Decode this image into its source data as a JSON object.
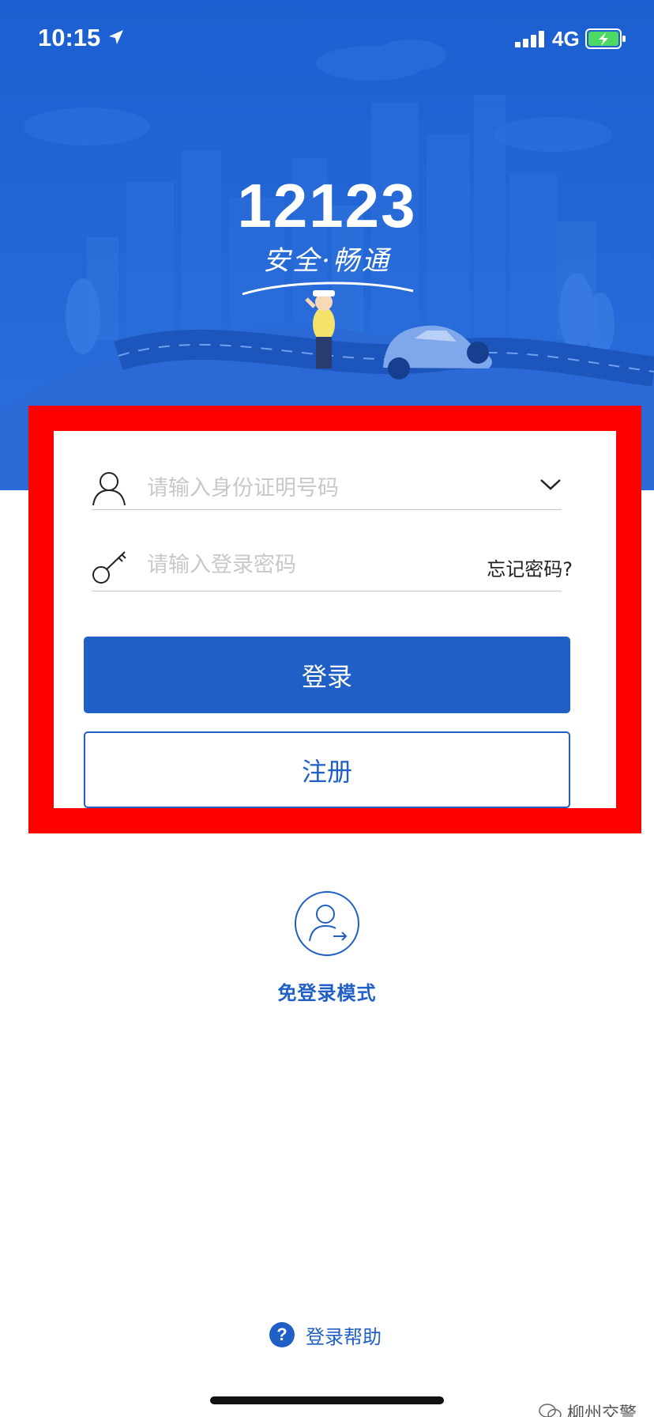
{
  "status_bar": {
    "time": "10:15",
    "network": "4G"
  },
  "hero": {
    "logo_number": "12123",
    "slogan": "安全·畅通"
  },
  "login_form": {
    "id_placeholder": "请输入身份证明号码",
    "password_placeholder": "请输入登录密码",
    "forgot_password": "忘记密码?",
    "login_button": "登录",
    "register_button": "注册"
  },
  "guest_mode": {
    "label": "免登录模式"
  },
  "help": {
    "icon_glyph": "?",
    "label": "登录帮助"
  },
  "watermark": {
    "text": "柳州交警"
  },
  "colors": {
    "primary": "#1f5fc6",
    "hero_background": "#1f63d2",
    "highlight": "#fe0000",
    "placeholder": "#c8c8cc"
  },
  "icons": {
    "location": "location-arrow-icon",
    "signal": "cellular-signal-icon",
    "battery": "battery-charging-icon",
    "user": "user-icon",
    "key": "key-icon",
    "dropdown": "chevron-down-icon",
    "guest": "guest-user-icon",
    "help": "question-circle-icon",
    "watermark": "wechat-icon"
  }
}
